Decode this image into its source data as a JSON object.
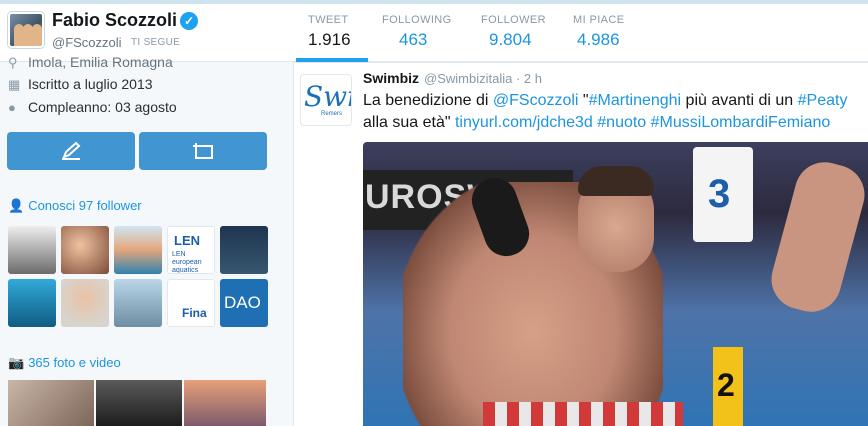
{
  "profile": {
    "name": "Fabio Scozzoli",
    "handle": "@FScozzoli",
    "follows_you": "TI SEGUE",
    "location": "Imola, Emilia Romagna",
    "joined": "Iscritto a luglio 2013",
    "birthday": "Compleanno: 03 agosto"
  },
  "stats": [
    {
      "label": "TWEET",
      "value": "1.916"
    },
    {
      "label": "FOLLOWING",
      "value": "463"
    },
    {
      "label": "FOLLOWER",
      "value": "9.804"
    },
    {
      "label": "MI PIACE",
      "value": "4.986"
    }
  ],
  "sidebar": {
    "followers_known": "Conosci 97 follower",
    "photos": "365 foto e video",
    "len_label": "LEN european aquatics",
    "fina_label": "Fina",
    "dao_label": "DAO"
  },
  "tweet": {
    "author": "Swimbiz",
    "handle": "@Swimbizitalia",
    "time": "2 h",
    "text_1": "La benedizione di ",
    "mention": "@FScozzoli",
    "text_2": " \"",
    "hashtag_1": "#Martinenghi",
    "text_3": " più avanti di un ",
    "hashtag_2": "#Peaty",
    "text_4": " alla sua età\" ",
    "link": "tinyurl.com/jdche3d",
    "hashtag_3": "#nuoto",
    "hashtag_4": "#MussiLombardiFemiano",
    "avatar_logo": "Swi",
    "avatar_sub": "Remers",
    "media": {
      "banner_text": "UROSWIM",
      "lane_number": "3",
      "lane_number_2": "2"
    }
  },
  "colors": {
    "accent": "#1da1f2",
    "link": "#1b95e0",
    "button": "#4196d1"
  }
}
